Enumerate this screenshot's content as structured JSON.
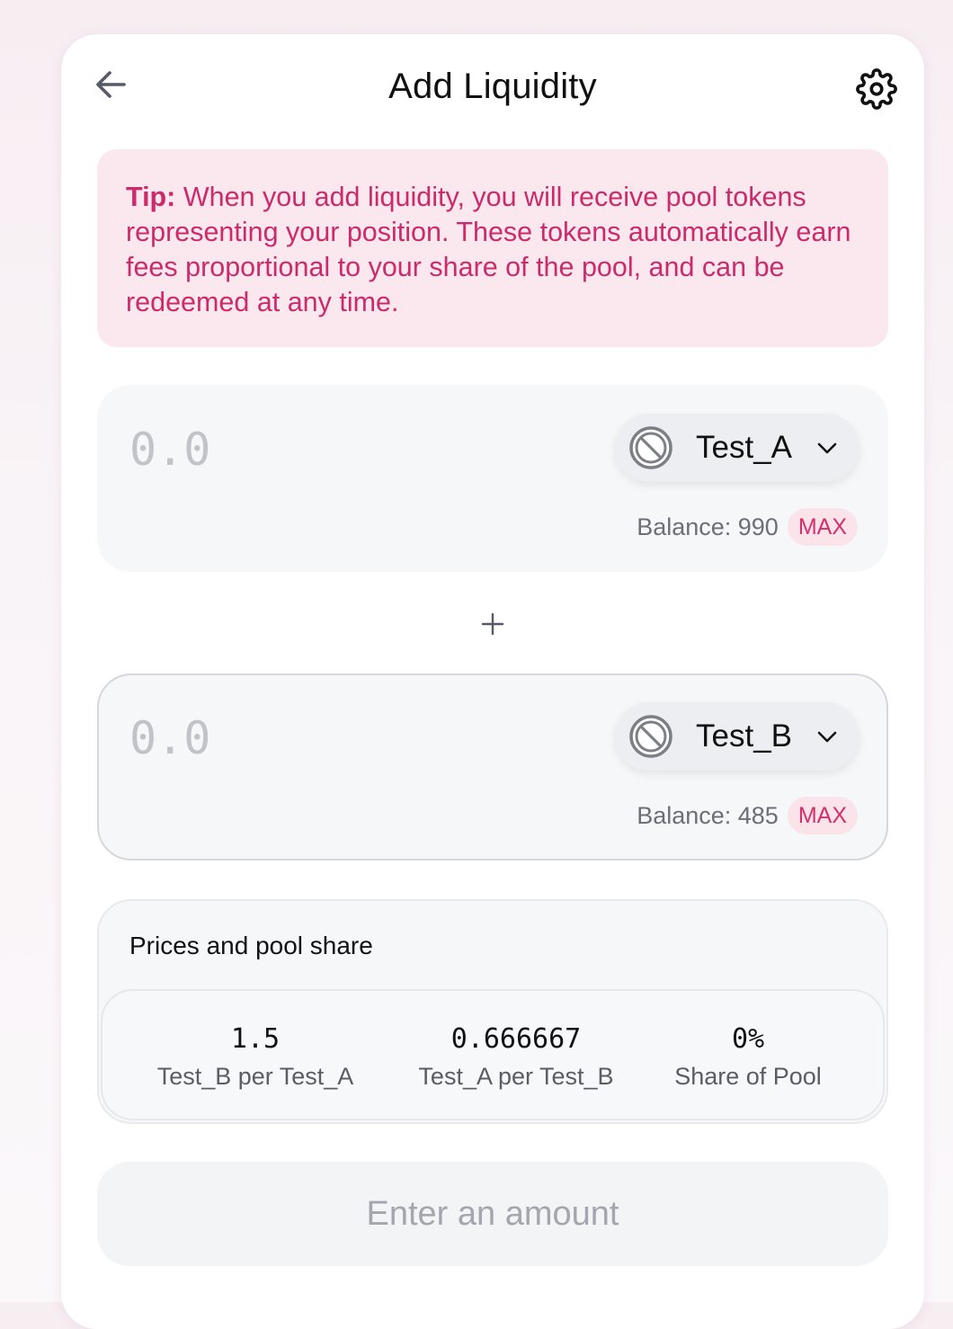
{
  "header": {
    "title": "Add Liquidity",
    "back_icon": "arrow-left-icon",
    "settings_icon": "gear-icon"
  },
  "tip": {
    "label": "Tip:",
    "text": "When you add liquidity, you will receive pool tokens representing your position. These tokens automatically earn fees proportional to your share of the pool, and can be redeemed at any time."
  },
  "token_a": {
    "amount_value": "",
    "amount_placeholder": "0.0",
    "symbol": "Test_A",
    "logo_icon": "no-token-logo-icon",
    "balance_text": "Balance: 990",
    "max_label": "MAX"
  },
  "token_b": {
    "amount_value": "",
    "amount_placeholder": "0.0",
    "symbol": "Test_B",
    "logo_icon": "no-token-logo-icon",
    "balance_text": "Balance: 485",
    "max_label": "MAX"
  },
  "separator_icon": "plus-icon",
  "prices": {
    "title": "Prices and pool share",
    "stats": [
      {
        "value": "1.5",
        "label": "Test_B per Test_A"
      },
      {
        "value": "0.666667",
        "label": "Test_A per Test_B"
      },
      {
        "value": "0%",
        "label": "Share of Pool"
      }
    ]
  },
  "submit": {
    "label": "Enter an amount"
  },
  "colors": {
    "accent": "#cc2a6a",
    "tip_background": "#fbe8ee",
    "panel_background": "#f6f7f9",
    "disabled_text": "#a3a6ae"
  }
}
